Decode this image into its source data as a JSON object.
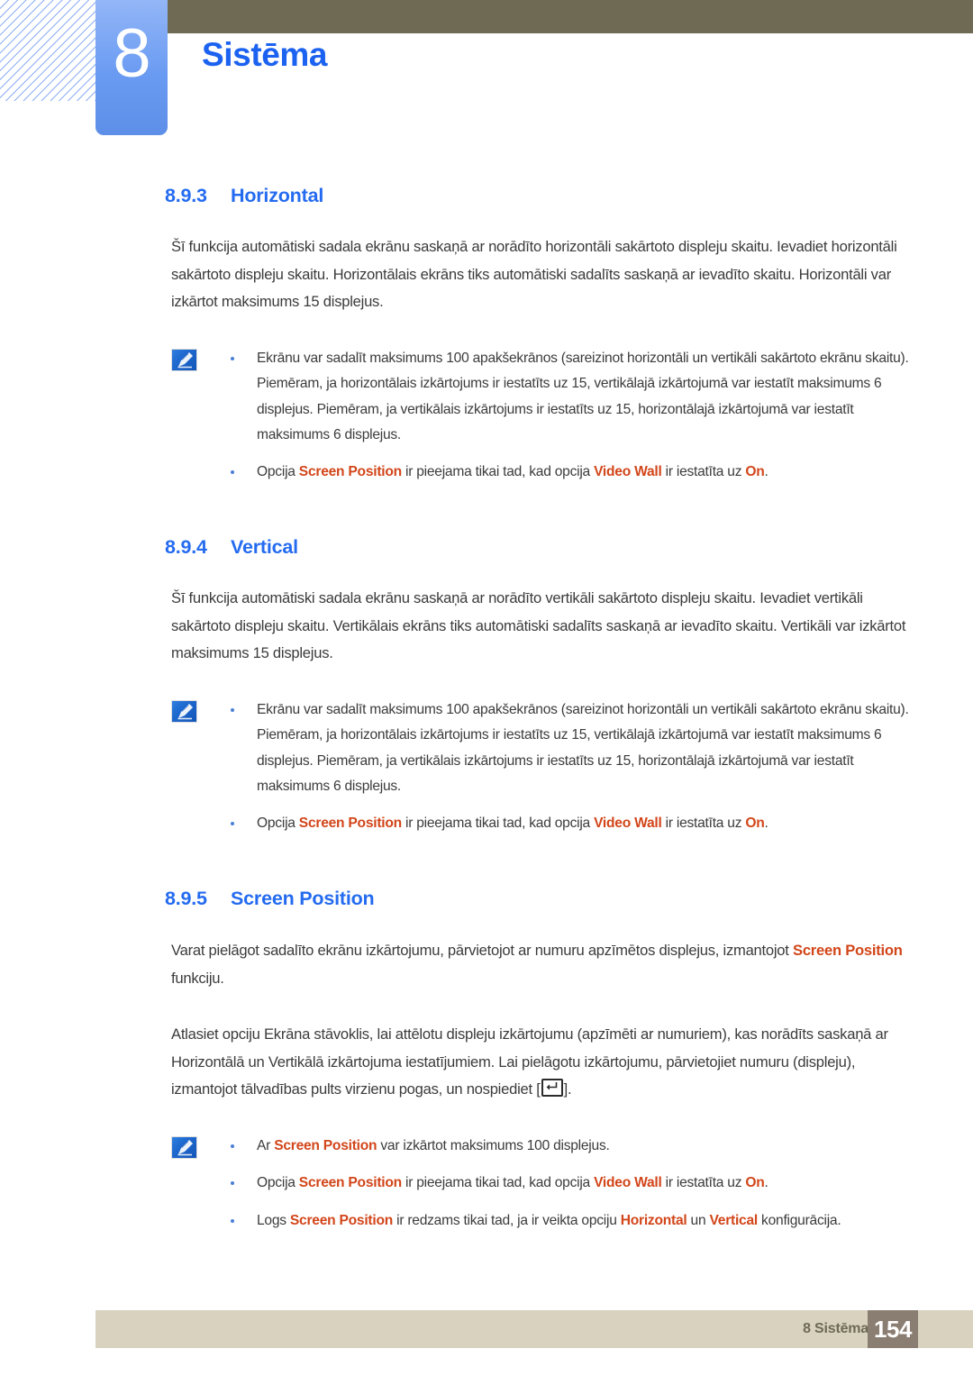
{
  "header": {
    "chapter_number": "8",
    "chapter_title": "Sistēma",
    "accent_blue": "#1c62f0",
    "olive": "#6e6a54"
  },
  "sections": [
    {
      "number": "8.9.3",
      "title": "Horizontal",
      "paragraph": "Šī funkcija automātiski sadala ekrānu saskaņā ar norādīto horizontāli sakārtoto displeju skaitu. Ievadiet horizontāli sakārtoto displeju skaitu. Horizontālais ekrāns tiks automātiski sadalīts saskaņā ar ievadīto skaitu. Horizontāli var izkārtot maksimums 15 displejus."
    },
    {
      "number": "8.9.4",
      "title": "Vertical",
      "paragraph": "Šī funkcija automātiski sadala ekrānu saskaņā ar norādīto vertikāli sakārtoto displeju skaitu. Ievadiet vertikāli sakārtoto displeju skaitu. Vertikālais ekrāns tiks automātiski sadalīts saskaņā ar ievadīto skaitu. Vertikāli var izkārtot maksimums 15 displejus."
    },
    {
      "number": "8.9.5",
      "title": "Screen Position"
    }
  ],
  "notes": {
    "horizontal": {
      "bullet1": {
        "text": "Ekrānu var sadalīt maksimums 100 apakšekrānos (sareizinot horizontāli un vertikāli sakārtoto ekrānu skaitu). Piemēram, ja horizontālais izkārtojums ir iestatīts uz 15, vertikālajā izkārtojumā var iestatīt maksimums 6 displejus. Piemēram, ja vertikālais izkārtojums ir iestatīts uz 15, horizontālajā izkārtojumā var iestatīt maksimums 6 displejus."
      },
      "bullet2": {
        "p1": "Opcija ",
        "t1": "Screen Position",
        "p2": " ir pieejama tikai tad, kad opcija ",
        "t2": "Video Wall",
        "p3": " ir iestatīta uz ",
        "t3": "On",
        "p4": "."
      }
    },
    "vertical": {
      "bullet1": {
        "text": "Ekrānu var sadalīt maksimums 100 apakšekrānos (sareizinot horizontāli un vertikāli sakārtoto ekrānu skaitu). Piemēram, ja horizontālais izkārtojums ir iestatīts uz 15, vertikālajā izkārtojumā var iestatīt maksimums 6 displejus. Piemēram, ja vertikālais izkārtojums ir iestatīts uz 15, horizontālajā izkārtojumā var iestatīt maksimums 6 displejus."
      },
      "bullet2": {
        "p1": "Opcija ",
        "t1": "Screen Position",
        "p2": " ir pieejama tikai tad, kad opcija ",
        "t2": "Video Wall",
        "p3": " ir iestatīta uz ",
        "t3": "On",
        "p4": "."
      }
    },
    "screen_position": {
      "bullet1": {
        "p1": "Ar ",
        "t1": "Screen Position",
        "p2": " var izkārtot maksimums 100 displejus."
      },
      "bullet2": {
        "p1": "Opcija ",
        "t1": "Screen Position",
        "p2": " ir pieejama tikai tad, kad opcija ",
        "t2": "Video Wall",
        "p3": " ir iestatīta uz ",
        "t3": "On",
        "p4": "."
      },
      "bullet3": {
        "p1": "Logs ",
        "t1": "Screen Position",
        "p2": " ir redzams tikai tad, ja ir veikta opciju ",
        "t2": "Horizontal",
        "p3": " un ",
        "t3": "Vertical",
        "p4": " konfigurācija."
      }
    }
  },
  "screen_position_body": {
    "para1": {
      "p1": "Varat pielāgot sadalīto ekrānu izkārtojumu, pārvietojot ar numuru apzīmētos displejus, izmantojot ",
      "t1": "Screen Position",
      "p2": " funkciju."
    },
    "para2": {
      "p1": "Atlasiet opciju Ekrāna stāvoklis, lai attēlotu displeju izkārtojumu (apzīmēti ar numuriem), kas norādīts saskaņā ar Horizontālā un Vertikālā izkārtojuma iestatījumiem. Lai pielāgotu izkārtojumu, pārvietojiet numuru (displeju), izmantojot tālvadības pults virzienu pogas, un nospiediet [",
      "p2": "]."
    }
  },
  "footer": {
    "label": "8 Sistēma",
    "page": "154",
    "band_color": "#d8d2bf",
    "page_box_color": "#8a7d72"
  },
  "colors": {
    "highlight_orange": "#d2461a",
    "heading_blue": "#246bf0",
    "body_gray": "#3b3b3b"
  }
}
